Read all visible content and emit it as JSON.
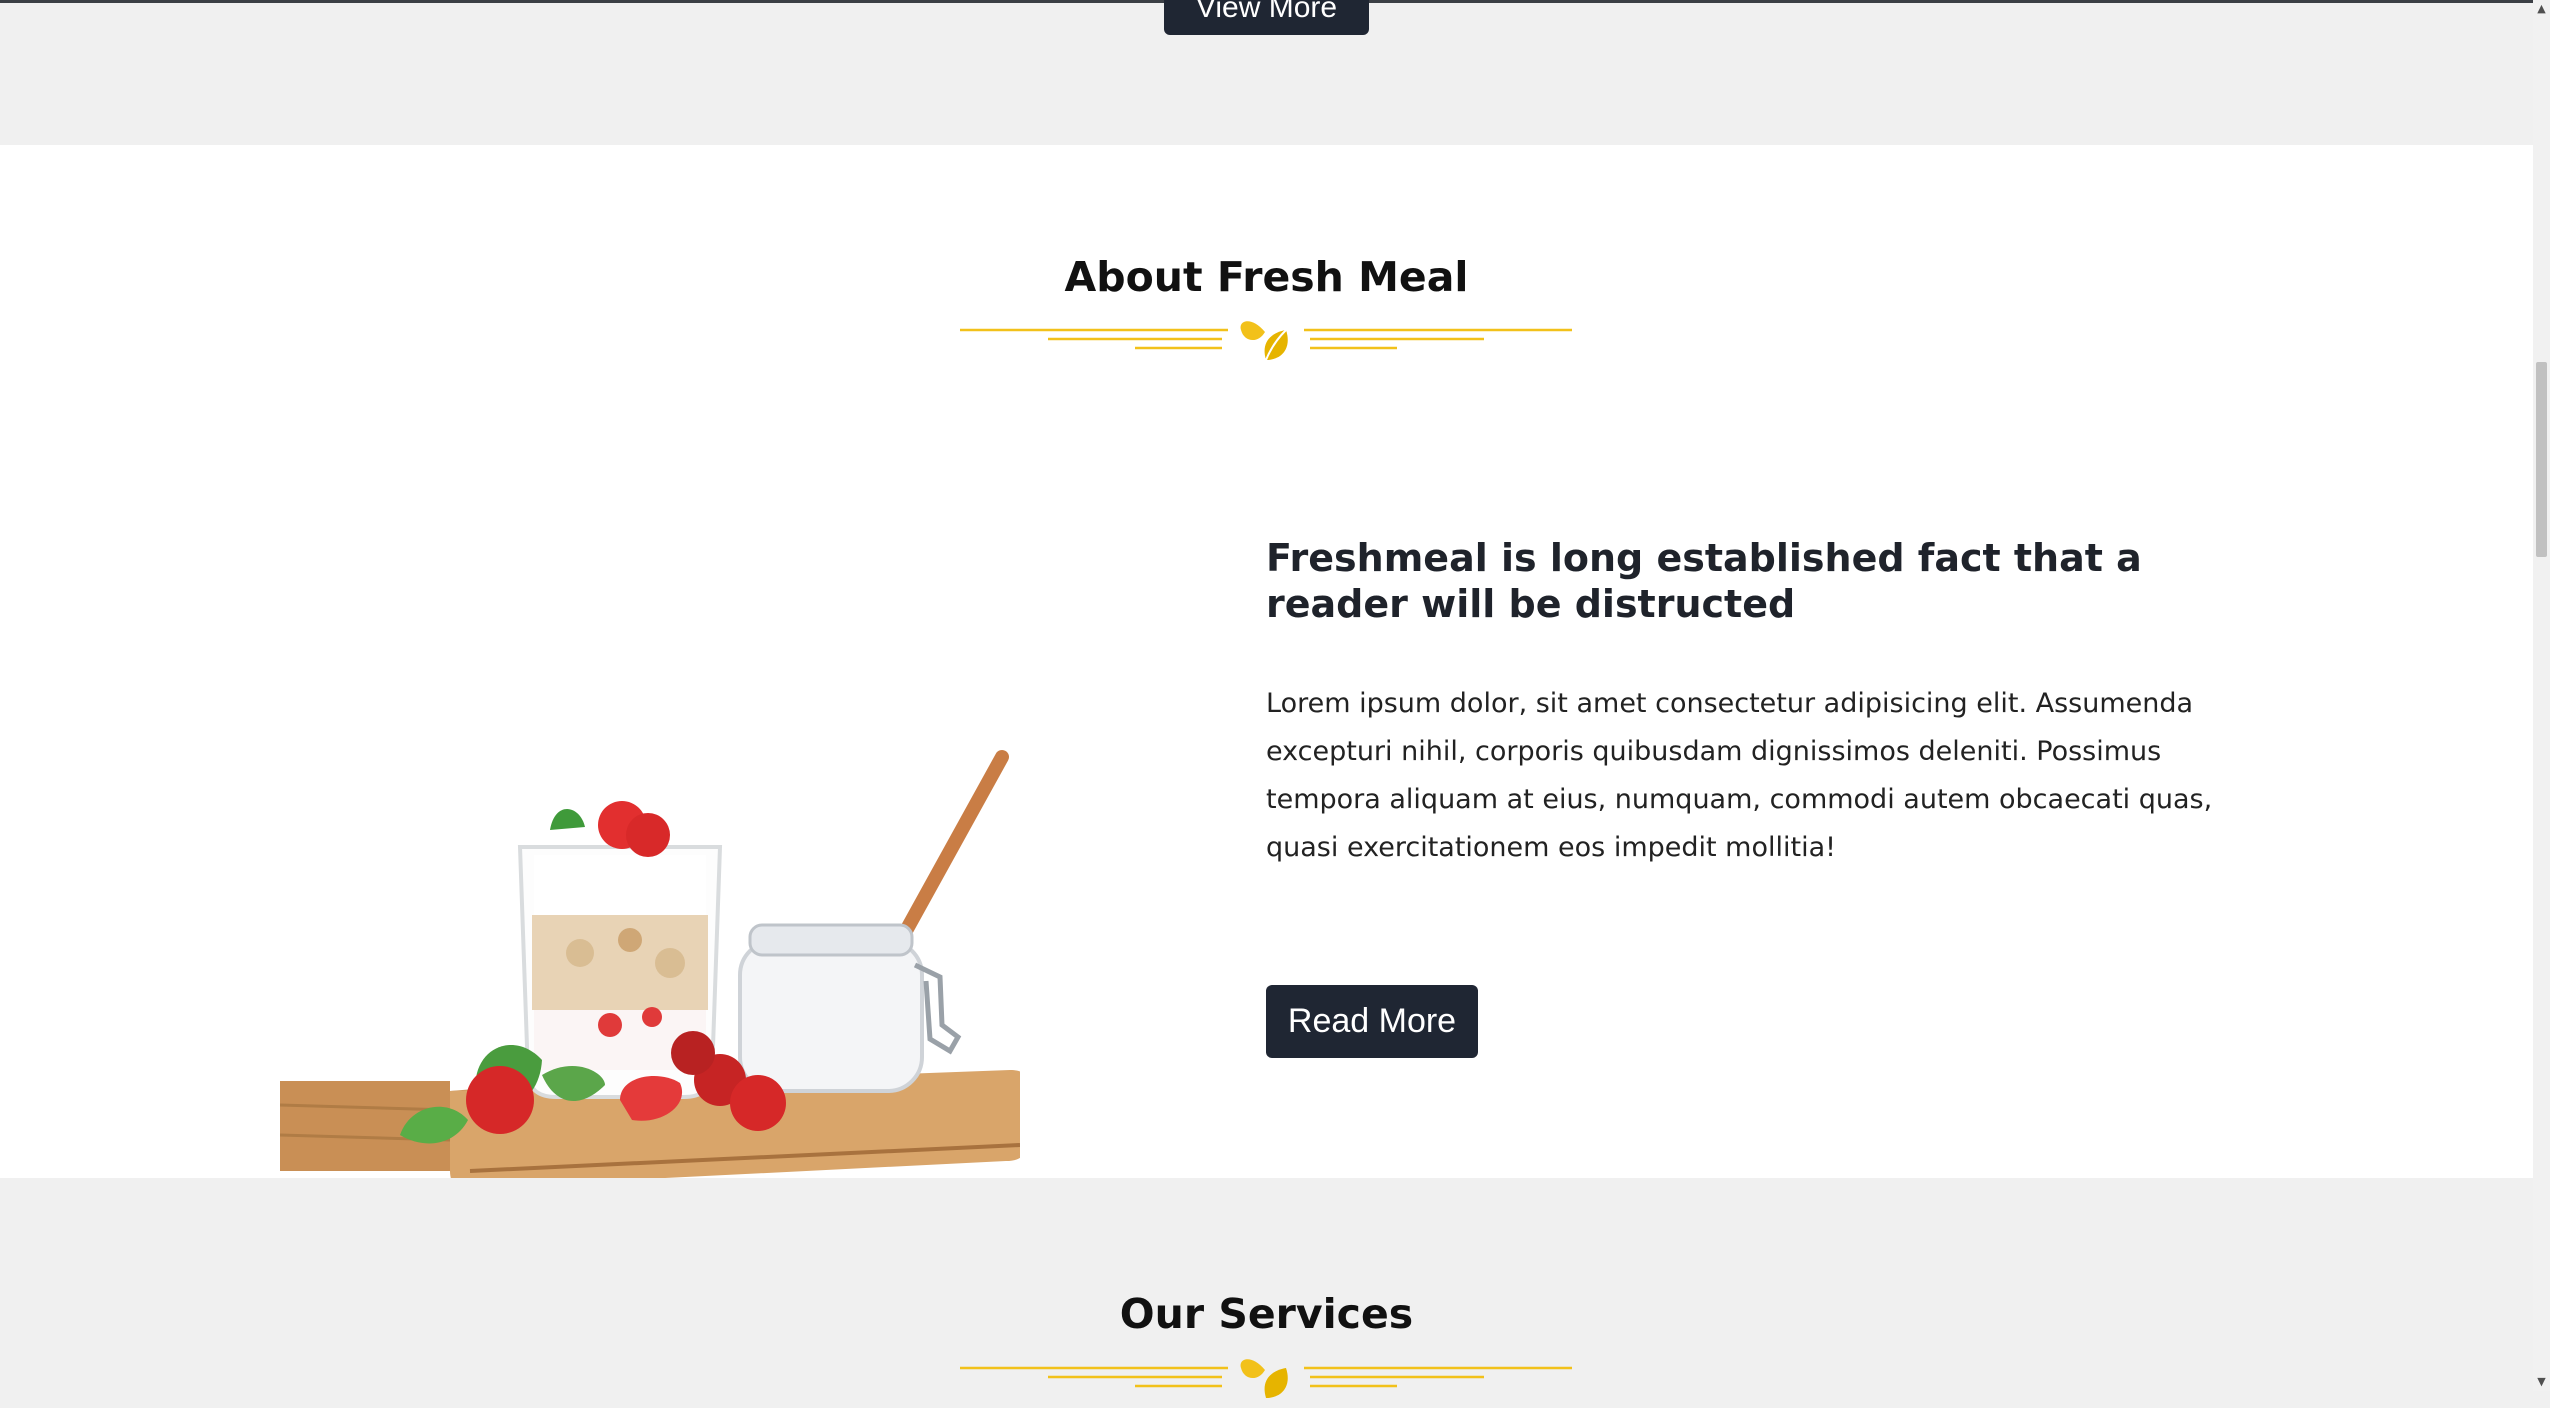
{
  "top": {
    "view_more_label": "View More"
  },
  "about": {
    "title": "About Fresh Meal",
    "heading": "Freshmeal is long established fact that a reader will be distructed",
    "body": "Lorem ipsum dolor, sit amet consectetur adipisicing elit. Assumenda excepturi nihil, corporis quibusdam dignissimos deleniti. Possimus tempora aliquam at eius, numquam, commodi autem obcaecati quas, quasi exercitationem eos impedit mollitia!",
    "read_more_label": "Read More"
  },
  "services": {
    "title": "Our Services"
  },
  "colors": {
    "accent": "#f2c11a",
    "button_bg": "#1f2633",
    "section_gray": "#f0f0f0"
  },
  "icons": {
    "divider": "leaf-icon",
    "scroll_up": "arrow-up-icon",
    "scroll_down": "arrow-down-icon"
  }
}
